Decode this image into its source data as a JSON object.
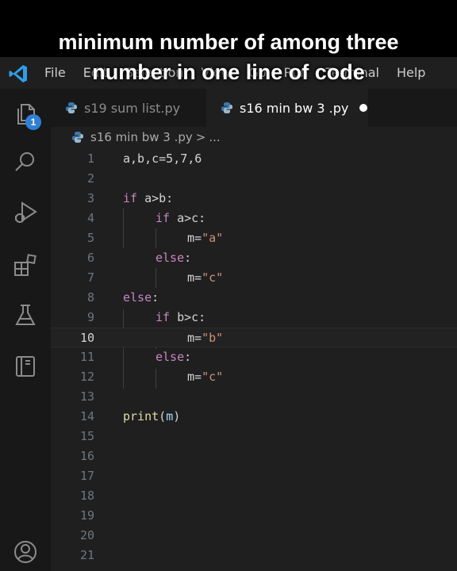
{
  "caption": {
    "line1": "minimum number of among three",
    "line2": "number in one line of code"
  },
  "menu": [
    "File",
    "Edit",
    "Selection",
    "View",
    "Go",
    "Run",
    "Terminal",
    "Help"
  ],
  "activity_bar": {
    "icons": [
      "files-icon",
      "search-icon",
      "run-debug-icon",
      "extensions-icon",
      "testing-icon",
      "remote-explorer-icon",
      "account-icon"
    ],
    "badge_count": "1"
  },
  "tabs": [
    {
      "label": "s19 sum list.py",
      "active": false
    },
    {
      "label": "s16 min bw 3 .py",
      "active": true,
      "modified": true
    }
  ],
  "breadcrumb": {
    "file": "s16 min bw 3 .py",
    "separator": ">",
    "rest": "..."
  },
  "editor": {
    "current_line": 10,
    "line_numbers": [
      "1",
      "2",
      "3",
      "4",
      "5",
      "6",
      "7",
      "8",
      "9",
      "10",
      "11",
      "12",
      "13",
      "14",
      "15",
      "16",
      "17",
      "18",
      "19",
      "20",
      "21"
    ],
    "code": {
      "l1": "a,b,c=5,7,6",
      "l3_kw": "if",
      "l3_rest": " a>b:",
      "l4_kw": "if",
      "l4_rest": " a>c:",
      "l5_var": "m=",
      "l5_str": "\"a\"",
      "l6_kw": "else",
      "l6_rest": ":",
      "l7_var": "m=",
      "l7_str": "\"c\"",
      "l8_kw": "else",
      "l8_rest": ":",
      "l9_kw": "if",
      "l9_rest": " b>c:",
      "l10_var": "m=",
      "l10_str": "\"b\"",
      "l11_kw": "else",
      "l11_rest": ":",
      "l12_var": "m=",
      "l12_str": "\"c\"",
      "l14_fn": "print",
      "l14_open": "(",
      "l14_arg": "m",
      "l14_close": ")"
    }
  },
  "colors": {
    "keyword": "#c586c0",
    "string": "#ce9178",
    "function": "#dcdcaa",
    "badge": "#2f7fd6",
    "editor_bg": "#1f1f1f"
  }
}
